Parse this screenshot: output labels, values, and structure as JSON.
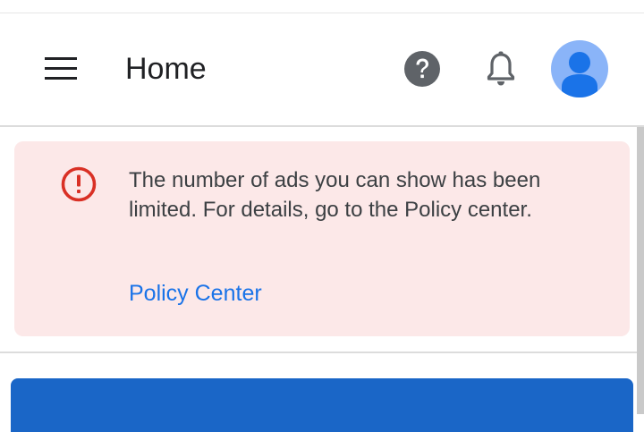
{
  "header": {
    "title": "Home",
    "menu_icon": "hamburger-menu-icon",
    "help_icon": "help-circle-icon",
    "notifications_icon": "bell-icon",
    "avatar_icon": "account-avatar-icon"
  },
  "alert": {
    "icon": "error-circle-icon",
    "message": "The number of ads you can show has been limited. For details, go to the Policy center.",
    "link_label": "Policy Center"
  },
  "colors": {
    "alert_background": "#fce8e8",
    "alert_icon": "#d93025",
    "link": "#1a73e8",
    "avatar": "#8ab4f8",
    "avatar_figure": "#1a73e8",
    "card_accent": "#1a66c7"
  }
}
